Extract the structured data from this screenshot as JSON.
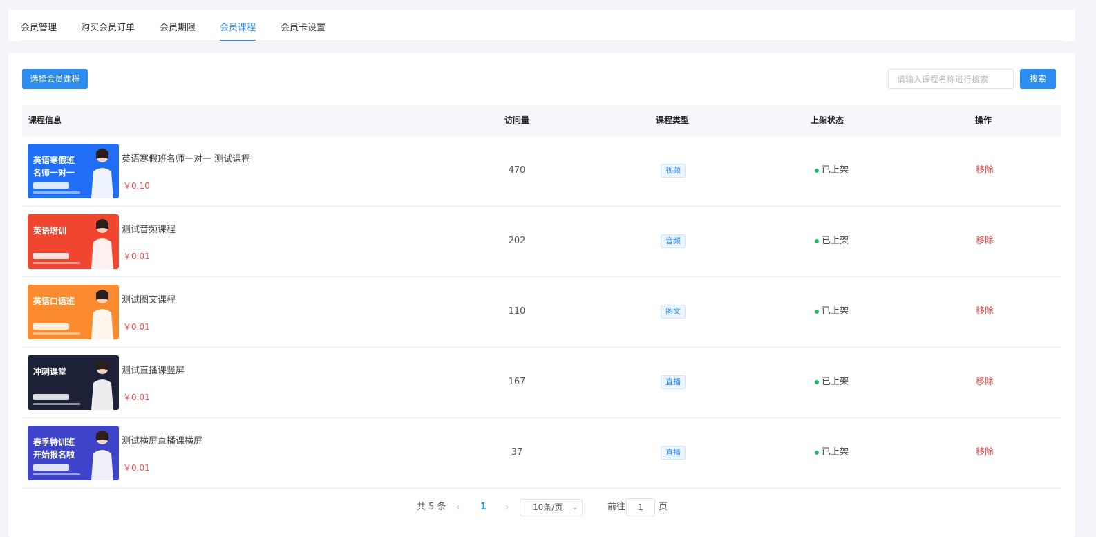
{
  "tabs": [
    {
      "label": "会员管理",
      "active": false
    },
    {
      "label": "购买会员订单",
      "active": false
    },
    {
      "label": "会员期限",
      "active": false
    },
    {
      "label": "会员课程",
      "active": true
    },
    {
      "label": "会员卡设置",
      "active": false
    }
  ],
  "toolbar": {
    "select_button_label": "选择会员课程",
    "search_placeholder": "请输入课程名称进行搜索",
    "search_value": "",
    "search_button_label": "搜索"
  },
  "table": {
    "columns": [
      "课程信息",
      "访问量",
      "课程类型",
      "上架状态",
      "操作"
    ],
    "rows": [
      {
        "title": "英语寒假班名师一对一 测试课程",
        "price": "￥0.10",
        "visits": "470",
        "type": "视频",
        "status": "已上架",
        "action": "移除",
        "thumb_lines": [
          "英语寒假班",
          "名师一对一"
        ],
        "thumb_bg": "#1f6ef5"
      },
      {
        "title": "测试音频课程",
        "price": "￥0.01",
        "visits": "202",
        "type": "音频",
        "status": "已上架",
        "action": "移除",
        "thumb_lines": [
          "英语培训"
        ],
        "thumb_bg": "#f0462f"
      },
      {
        "title": "测试图文课程",
        "price": "￥0.01",
        "visits": "110",
        "type": "图文",
        "status": "已上架",
        "action": "移除",
        "thumb_lines": [
          "英语口语班"
        ],
        "thumb_bg": "#fb8b2e"
      },
      {
        "title": "测试直播课竖屏",
        "price": "￥0.01",
        "visits": "167",
        "type": "直播",
        "status": "已上架",
        "action": "移除",
        "thumb_lines": [
          "冲刺课堂"
        ],
        "thumb_bg": "#1c2138"
      },
      {
        "title": "测试横屏直播课横屏",
        "price": "￥0.01",
        "visits": "37",
        "type": "直播",
        "status": "已上架",
        "action": "移除",
        "thumb_lines": [
          "春季特训班",
          "开始报名啦"
        ],
        "thumb_bg": "#3d44c9"
      }
    ]
  },
  "pagination": {
    "total_text": "共 5 条",
    "current_page": "1",
    "page_size": "10条/页",
    "goto_label": "前往",
    "goto_value": "1",
    "page_suffix": "页"
  },
  "colors": {
    "primary": "#2d8cf0",
    "danger": "#f04a4a",
    "success": "#19be6b"
  }
}
